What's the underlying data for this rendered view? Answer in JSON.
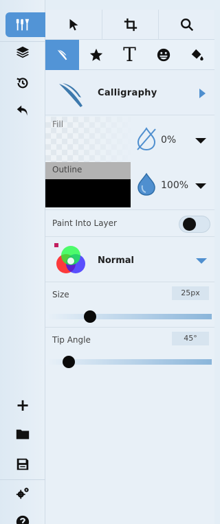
{
  "rail": {
    "top_icons": [
      "brushes-icon",
      "layers-icon",
      "history-icon",
      "undo-icon"
    ],
    "bottom_icons": [
      "add-icon",
      "folder-icon",
      "save-icon",
      "settings-icon",
      "help-icon"
    ],
    "add_glyph": "+"
  },
  "toolbar1": [
    "cursor-icon",
    "crop-icon",
    "search-icon"
  ],
  "toolbar2": {
    "tools": [
      "calligraphy-brush-icon",
      "star-icon",
      "text-icon",
      "emoji-icon",
      "paint-bucket-icon"
    ],
    "text_glyph": "T",
    "active": 0
  },
  "brush": {
    "label": "Calligraphy"
  },
  "fill": {
    "label": "Fill",
    "opacity": "0%"
  },
  "outline": {
    "label": "Outline",
    "opacity": "100%"
  },
  "paint_into_layer": {
    "label": "Paint Into Layer",
    "on": false
  },
  "blend": {
    "label": "Normal"
  },
  "size": {
    "label": "Size",
    "value": "25px",
    "level": 0.27
  },
  "tip_angle": {
    "label": "Tip Angle",
    "value": "45°",
    "level": 0.14
  },
  "colors": {
    "accent": "#5294d6",
    "panel": "#e8f0f7"
  }
}
